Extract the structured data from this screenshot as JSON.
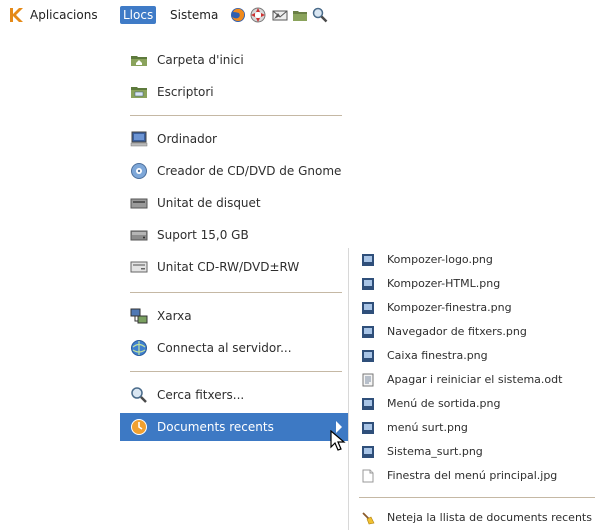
{
  "panel": {
    "menus": [
      "Aplicacions",
      "Llocs",
      "Sistema"
    ],
    "active_menu": "Llocs",
    "launchers": [
      "firefox-icon",
      "help-icon",
      "mail-icon",
      "folder-icon",
      "search-icon"
    ]
  },
  "places_menu": {
    "items": [
      {
        "label": "Carpeta d'inici",
        "icon": "home-folder-icon"
      },
      {
        "label": "Escriptori",
        "icon": "desktop-folder-icon"
      },
      {
        "label": "Ordinador",
        "icon": "computer-icon"
      },
      {
        "label": "Creador de CD/DVD de Gnome",
        "icon": "cd-burner-icon"
      },
      {
        "label": "Unitat de disquet",
        "icon": "floppy-drive-icon"
      },
      {
        "label": "Suport 15,0 GB",
        "icon": "hard-drive-icon"
      },
      {
        "label": "Unitat CD-RW/DVD±RW",
        "icon": "optical-drive-icon"
      },
      {
        "label": "Xarxa",
        "icon": "network-icon"
      },
      {
        "label": "Connecta al servidor...",
        "icon": "connect-server-icon"
      },
      {
        "label": "Cerca fitxers...",
        "icon": "search-icon"
      },
      {
        "label": "Documents recents",
        "icon": "recent-documents-icon"
      }
    ]
  },
  "recent_documents": {
    "items": [
      {
        "label": "Kompozer-logo.png",
        "icon": "image-file-icon"
      },
      {
        "label": "Kompozer-HTML.png",
        "icon": "image-file-icon"
      },
      {
        "label": "Kompozer-finestra.png",
        "icon": "image-file-icon"
      },
      {
        "label": "Navegador de fitxers.png",
        "icon": "image-file-icon"
      },
      {
        "label": "Caixa finestra.png",
        "icon": "image-file-icon"
      },
      {
        "label": "Apagar i reiniciar el sistema.odt",
        "icon": "document-file-icon"
      },
      {
        "label": "Menú de sortida.png",
        "icon": "image-file-icon"
      },
      {
        "label": "menú surt.png",
        "icon": "image-file-icon"
      },
      {
        "label": "Sistema_surt.png",
        "icon": "image-file-icon"
      },
      {
        "label": "Finestra del menú principal.jpg",
        "icon": "text-file-icon"
      }
    ],
    "clear_label": "Neteja la llista de documents recents"
  },
  "colors": {
    "highlight": "#3d79c4",
    "separator": "#c5b8a4"
  }
}
